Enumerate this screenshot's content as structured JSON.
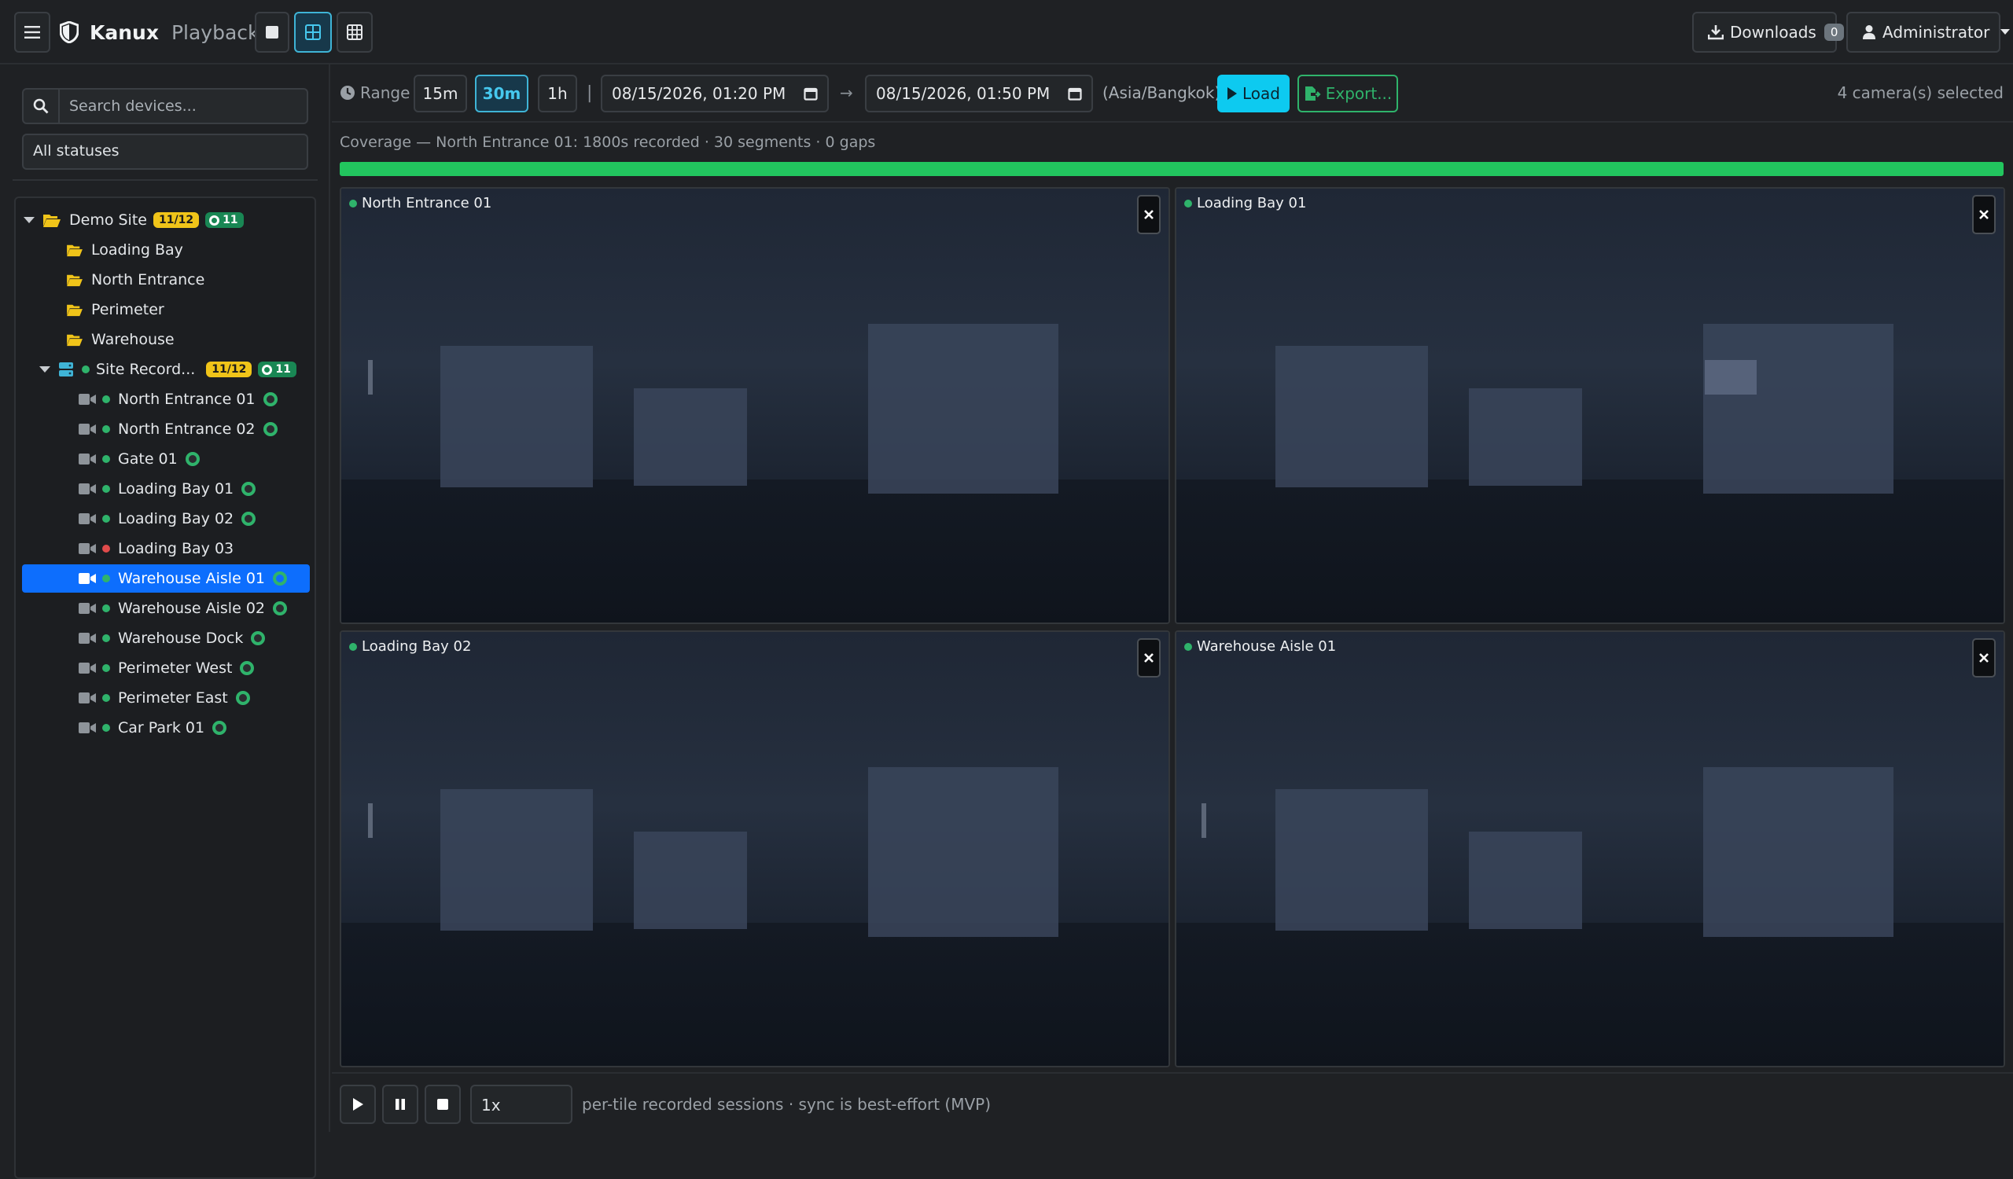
{
  "app": {
    "name": "Kanux",
    "page": "Playback"
  },
  "header": {
    "downloads_label": "Downloads",
    "downloads_count": "0",
    "user_label": "Administrator"
  },
  "sidebar": {
    "search_placeholder": "Search devices...",
    "status_filter": "All statuses",
    "tree": {
      "site": {
        "label": "Demo Site",
        "badge": "11/12",
        "online": "11"
      },
      "groups": [
        "Loading Bay",
        "North Entrance",
        "Perimeter",
        "Warehouse"
      ],
      "recorder": {
        "label": "Site Record...",
        "badge": "11/12",
        "online": "11"
      },
      "cameras": [
        {
          "label": "North Entrance 01",
          "status": "online"
        },
        {
          "label": "North Entrance 02",
          "status": "online"
        },
        {
          "label": "Gate 01",
          "status": "online"
        },
        {
          "label": "Loading Bay 01",
          "status": "online"
        },
        {
          "label": "Loading Bay 02",
          "status": "online"
        },
        {
          "label": "Loading Bay 03",
          "status": "offline"
        },
        {
          "label": "Warehouse Aisle 01",
          "status": "online",
          "selected": true
        },
        {
          "label": "Warehouse Aisle 02",
          "status": "online"
        },
        {
          "label": "Warehouse Dock",
          "status": "online"
        },
        {
          "label": "Perimeter West",
          "status": "online"
        },
        {
          "label": "Perimeter East",
          "status": "online"
        },
        {
          "label": "Car Park 01",
          "status": "online"
        }
      ]
    }
  },
  "controls": {
    "range_label": "Range",
    "ranges": [
      "15m",
      "30m",
      "1h"
    ],
    "active_range": "30m",
    "start": "08/15/2026, 01:20 PM",
    "end": "08/15/2026, 01:50 PM",
    "timezone": "(Asia/Bangkok)",
    "load_label": "Load",
    "export_label": "Export...",
    "selected_text": "4 camera(s) selected"
  },
  "coverage": {
    "text": "Coverage — North Entrance 01: 1800s recorded · 30 segments · 0 gaps",
    "fraction": 1.0
  },
  "tiles": [
    "North Entrance 01",
    "Loading Bay 01",
    "Loading Bay 02",
    "Warehouse Aisle 01"
  ],
  "playback": {
    "speed": "1x",
    "note": "per-tile recorded sessions · sync is best-effort (MVP)"
  },
  "colors": {
    "accent": "#0d6efd",
    "info": "#0dcaf0",
    "success": "#22c55e",
    "warning": "#f0c419",
    "danger": "#e04b4b"
  }
}
